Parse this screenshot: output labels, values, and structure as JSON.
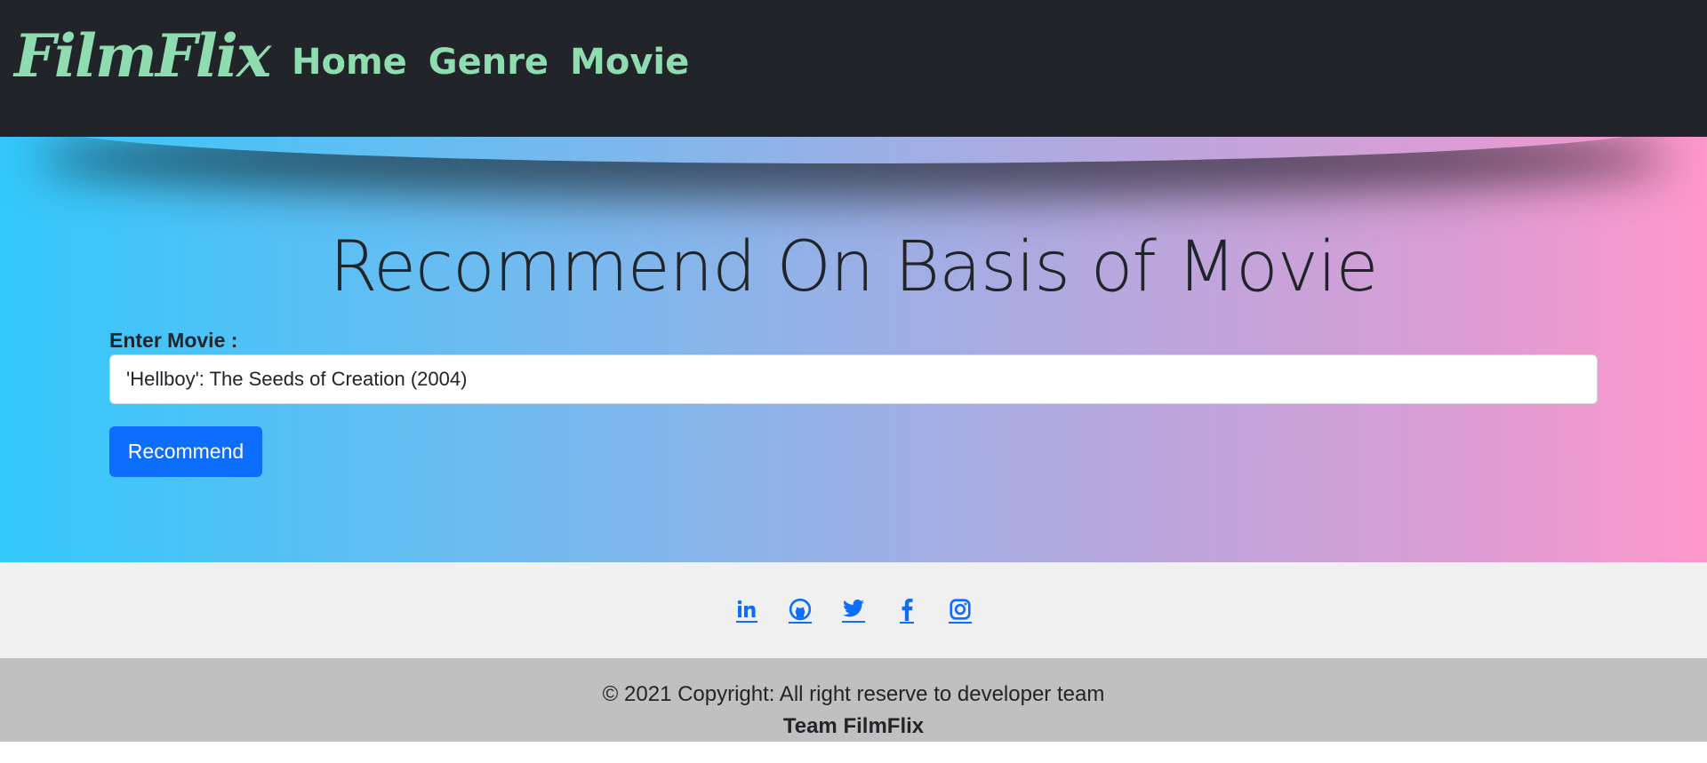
{
  "navbar": {
    "brand": "FilmFlix",
    "links": [
      {
        "label": "Home"
      },
      {
        "label": "Genre"
      },
      {
        "label": "Movie"
      }
    ]
  },
  "hero": {
    "title": "Recommend On Basis of Movie",
    "field_label": "Enter Movie :",
    "input_value": "'Hellboy': The Seeds of Creation (2004)",
    "button_label": "Recommend"
  },
  "social": {
    "icons": [
      "linkedin-icon",
      "github-icon",
      "twitter-icon",
      "facebook-icon",
      "instagram-icon"
    ],
    "link_color": "#0d6efd"
  },
  "footer": {
    "copyright": "© 2021 Copyright: All right reserve to developer team",
    "team": "Team FilmFlix"
  },
  "colors": {
    "navbar_bg": "#212529",
    "brand_accent": "#8fdcb0",
    "gradient_start": "#33c8fb",
    "gradient_end": "#ff98cc",
    "button_primary": "#0d6efd"
  }
}
